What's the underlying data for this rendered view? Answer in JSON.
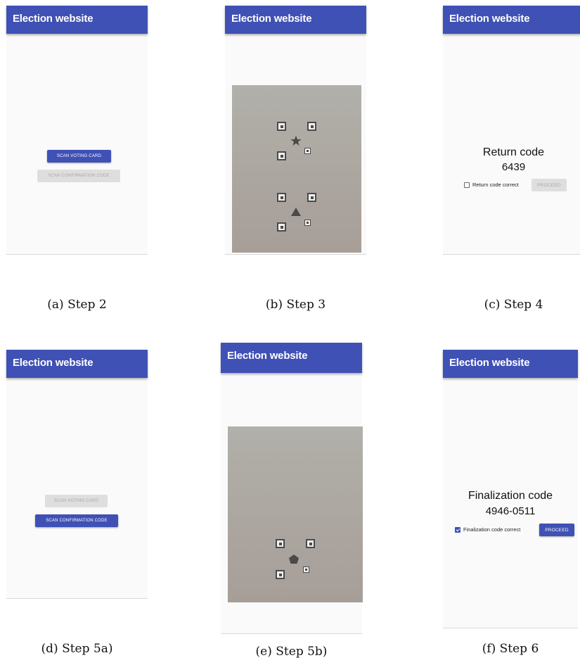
{
  "panels": [
    {
      "app_title": "Election website",
      "caption": "(a) Step 2",
      "scan_voting_card_label": "SCAN VOTING CARD",
      "scan_confirmation_code_label": "SCAN CONFIRMATION CODE"
    },
    {
      "app_title": "Election website",
      "caption": "(b) Step 3"
    },
    {
      "app_title": "Election website",
      "caption": "(c) Step 4",
      "code_title": "Return code",
      "code_value": "6439",
      "checkbox_label": "Return code correct",
      "checkbox_checked": false,
      "proceed_label": "PROCEED"
    },
    {
      "app_title": "Election website",
      "caption": "(d) Step 5a)",
      "scan_voting_card_label": "SCAN VOTING CARD",
      "scan_confirmation_code_label": "SCAN CONFIRMATION CODE"
    },
    {
      "app_title": "Election website",
      "caption": "(e) Step 5b)"
    },
    {
      "app_title": "Election website",
      "caption": "(f) Step 6",
      "code_title": "Finalization code",
      "code_value": "4946-0511",
      "checkbox_label": "Finalization code correct",
      "checkbox_checked": true,
      "proceed_label": "PROCEED"
    }
  ],
  "colors": {
    "app_bar": "#3f51b5",
    "disabled_button": "#dedede",
    "camera_background": "#aca6a0"
  },
  "icons": {
    "step3_top_symbol": "star-icon",
    "step3_bottom_symbol": "triangle-icon",
    "step5b_symbol": "pentagon-icon"
  }
}
